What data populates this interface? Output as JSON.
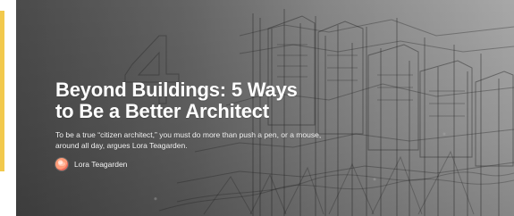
{
  "hero": {
    "title": "Beyond Buildings: 5 Ways to Be a Better Architect",
    "subtitle": "To be a true “citizen architect,” you must do more than push a pen, or a mouse, around all day, argues Lora Teagarden.",
    "author": {
      "name": "Lora Teagarden",
      "avatar_icon": "author-avatar"
    }
  },
  "colors": {
    "accent": "#f2c94c"
  }
}
